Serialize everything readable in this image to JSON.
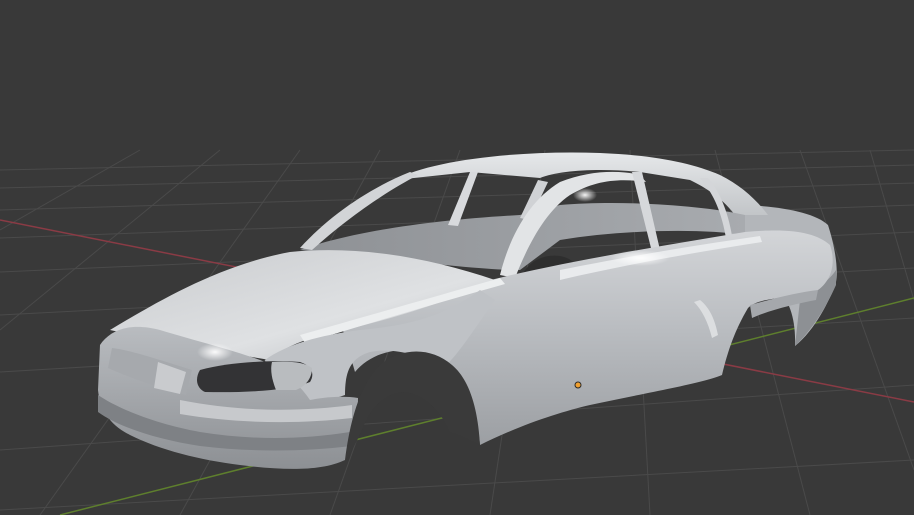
{
  "viewport": {
    "view": "3d-viewport",
    "background_color": "#393939",
    "grid_color": "#4a4a4a",
    "x_axis_color": "#8a3b45",
    "y_axis_color": "#5e7f2d"
  },
  "object": {
    "name": "car-body-shell",
    "body_color": "#c4c6c9",
    "highlight_color": "#eef0f2",
    "shadow_color": "#8f9296",
    "origin_color": "#f0a030"
  }
}
